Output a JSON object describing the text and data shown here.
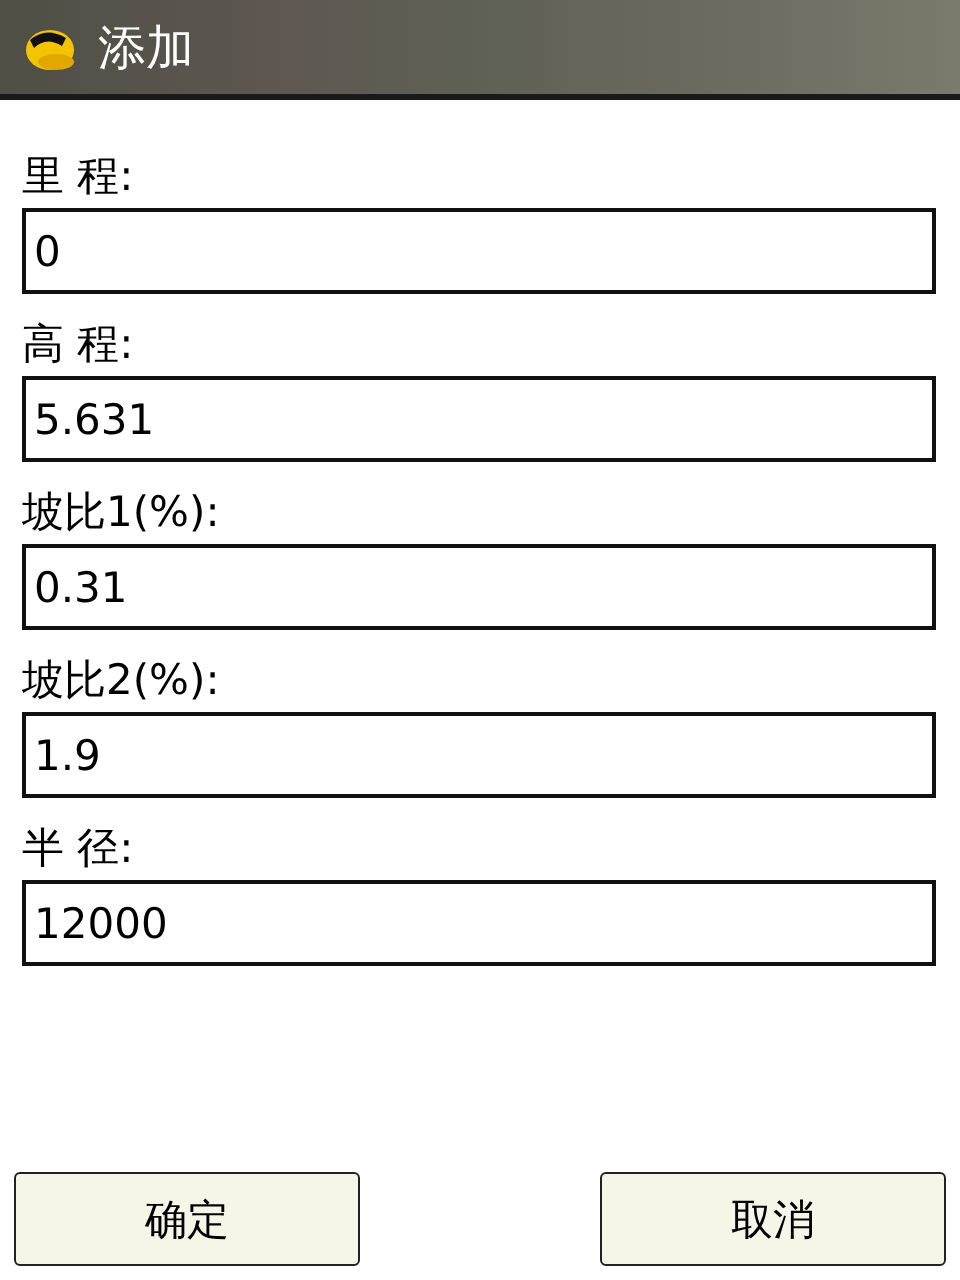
{
  "window": {
    "title": "添加"
  },
  "fields": [
    {
      "label": "里 程:",
      "value": "0"
    },
    {
      "label": "高 程:",
      "value": "5.631"
    },
    {
      "label": "坡比1(%):",
      "value": "0.31"
    },
    {
      "label": "坡比2(%):",
      "value": "1.9"
    },
    {
      "label": "半 径:",
      "value": "12000"
    }
  ],
  "buttons": [
    "确定",
    "取消"
  ]
}
